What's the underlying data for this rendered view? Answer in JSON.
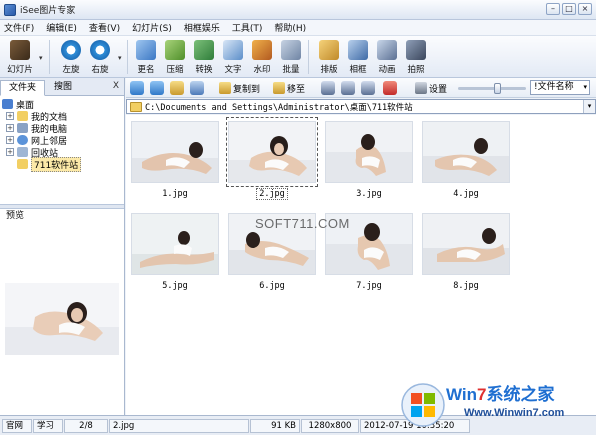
{
  "window": {
    "title": "iSee图片专家",
    "buttons": [
      "–",
      "□",
      "×"
    ]
  },
  "menu": [
    "文件(F)",
    "编辑(E)",
    "查看(V)",
    "幻灯片(S)",
    "相框娱乐",
    "工具(T)",
    "帮助(H)"
  ],
  "toolbar": {
    "slideshow": "幻灯片",
    "rotate_left": "左旋",
    "rotate_right": "右旋",
    "rename": "更名",
    "compress": "压缩",
    "convert": "转换",
    "text": "文字",
    "watermark": "水印",
    "batch": "批量",
    "layout": "排版",
    "frame": "相框",
    "animation": "动画",
    "capture": "拍照"
  },
  "left_tabs": {
    "folders": "文件夹",
    "search": "搜图",
    "close": "X"
  },
  "tree": [
    {
      "label": "桌面",
      "expander": "-",
      "icon_color": "#4a7fd0"
    },
    {
      "label": "我的文档",
      "expander": "+",
      "icon_color": "#f2cf63"
    },
    {
      "label": "我的电脑",
      "expander": "+",
      "icon_color": "#8aa2c4"
    },
    {
      "label": "网上邻居",
      "expander": "+",
      "icon_color": "#5b93d9"
    },
    {
      "label": "回收站",
      "expander": "+",
      "icon_color": "#9fb6d4"
    },
    {
      "label": "711软件站",
      "expander": "",
      "icon_color": "#f2cf63"
    }
  ],
  "preview": {
    "title": "预览"
  },
  "nav": {
    "copy_to": "复制到",
    "move_to": "移至",
    "settings": "设置",
    "sort": "!文件名称",
    "path": "C:\\Documents and Settings\\Administrator\\桌面\\711软件站"
  },
  "thumbnails": [
    "1.jpg",
    "2.jpg",
    "3.jpg",
    "4.jpg",
    "5.jpg",
    "6.jpg",
    "7.jpg",
    "8.jpg"
  ],
  "watermark_text": "SOFT711.COM",
  "status": {
    "mode1": "官网",
    "mode2": "学习",
    "position": "2/8",
    "file": "2.jpg",
    "size": "91 KB",
    "dimensions": "1280x800",
    "date": "2012-07-19 10:35:20"
  },
  "site_logo": {
    "text_a": "Win",
    "text_num": "7",
    "text_b": "系统之家",
    "url": "Www.Winwin7.com"
  }
}
